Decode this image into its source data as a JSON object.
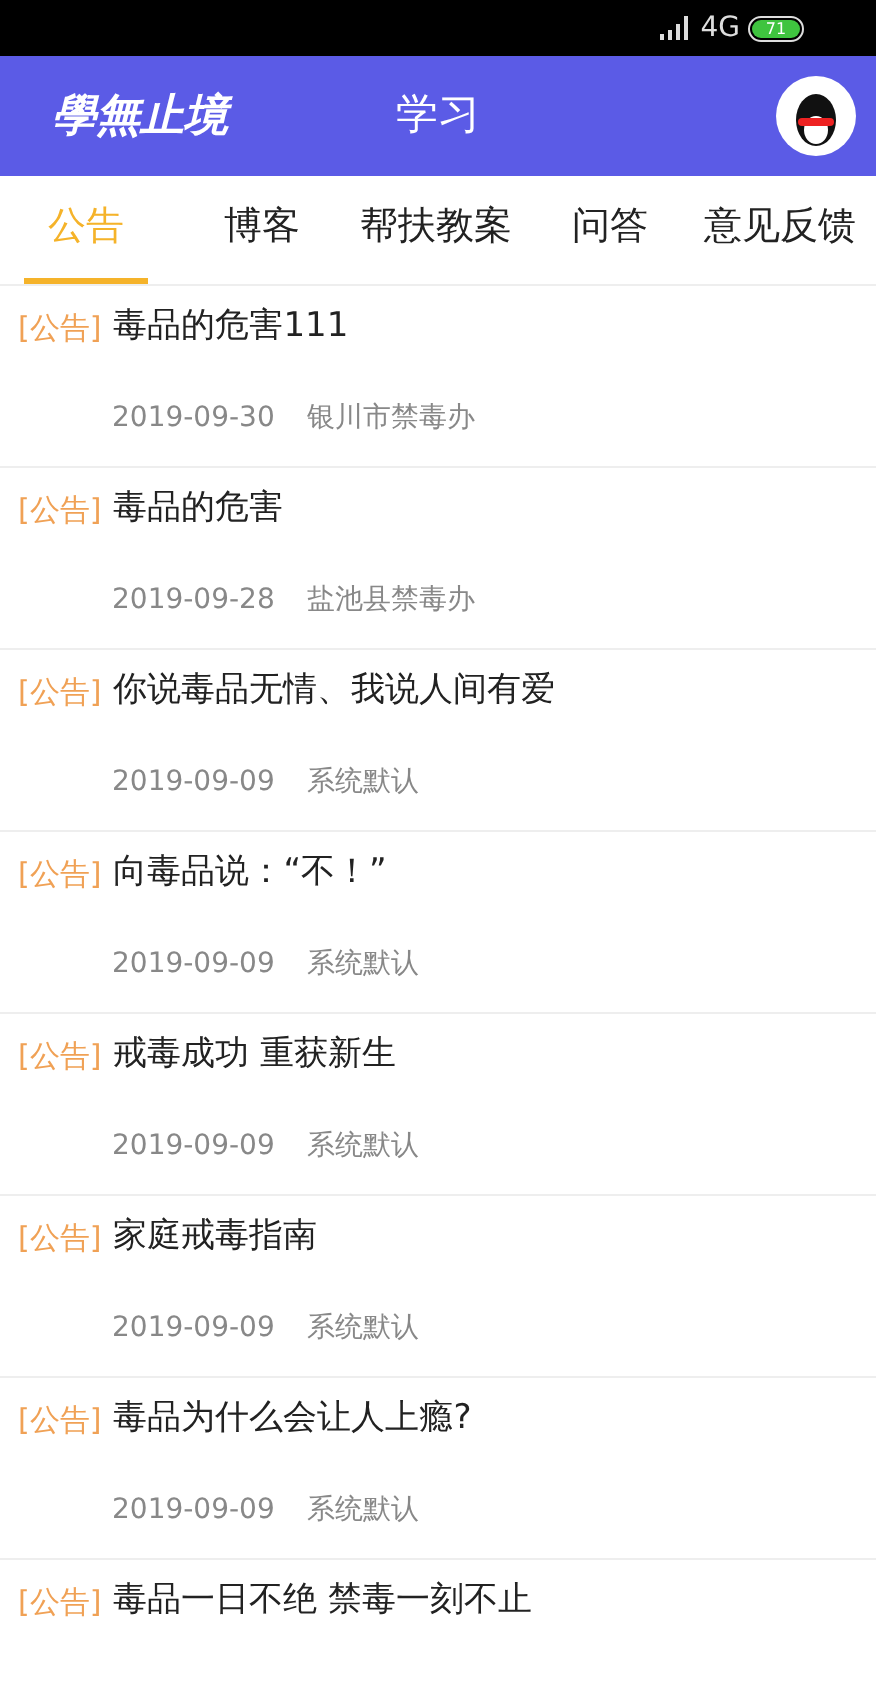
{
  "status_bar": {
    "network": "4G",
    "battery": "71"
  },
  "header": {
    "logo": "學無止境",
    "title": "学习"
  },
  "tabs": [
    {
      "label": "公告",
      "selected": true
    },
    {
      "label": "博客",
      "selected": false
    },
    {
      "label": "帮扶教案",
      "selected": false
    },
    {
      "label": "问答",
      "selected": false
    },
    {
      "label": "意见反馈",
      "selected": false
    }
  ],
  "posts": [
    {
      "tag": "[公告]",
      "title": "毒品的危害111",
      "date": "2019-09-30",
      "source": "银川市禁毒办"
    },
    {
      "tag": "[公告]",
      "title": "毒品的危害",
      "date": "2019-09-28",
      "source": "盐池县禁毒办"
    },
    {
      "tag": "[公告]",
      "title": "你说毒品无情、我说人间有爱",
      "date": "2019-09-09",
      "source": "系统默认"
    },
    {
      "tag": "[公告]",
      "title": "向毒品说：“不！”",
      "date": "2019-09-09",
      "source": "系统默认"
    },
    {
      "tag": "[公告]",
      "title": "戒毒成功 重获新生",
      "date": "2019-09-09",
      "source": "系统默认"
    },
    {
      "tag": "[公告]",
      "title": "家庭戒毒指南",
      "date": "2019-09-09",
      "source": "系统默认"
    },
    {
      "tag": "[公告]",
      "title": "毒品为什么会让人上瘾?",
      "date": "2019-09-09",
      "source": "系统默认"
    },
    {
      "tag": "[公告]",
      "title": "毒品一日不绝 禁毒一刻不止"
    }
  ]
}
